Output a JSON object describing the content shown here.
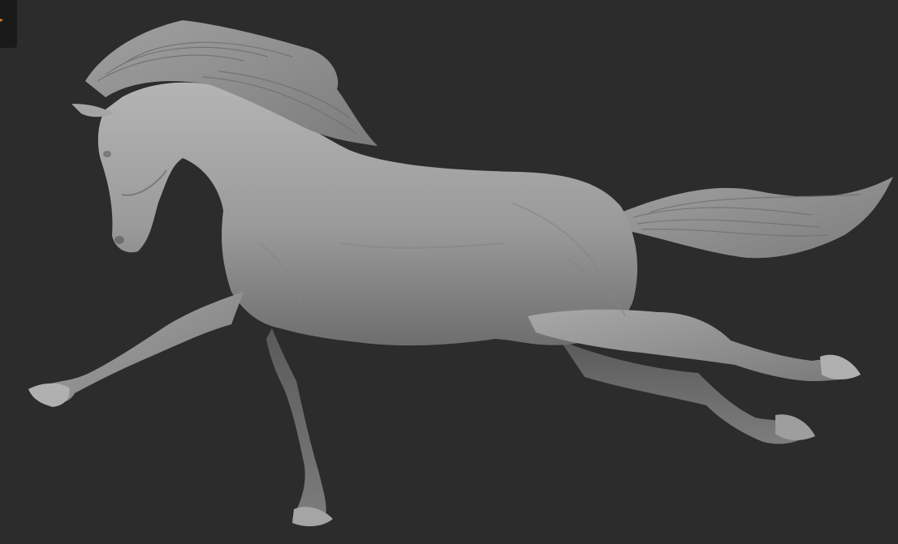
{
  "viewport": {
    "background_color": "#2c2c2c",
    "model_color": "#9a9a9a",
    "model_name": "horse-sculpt"
  },
  "corner_widget": {
    "icon": "app-menu-icon",
    "accent_color": "#e07a20"
  }
}
